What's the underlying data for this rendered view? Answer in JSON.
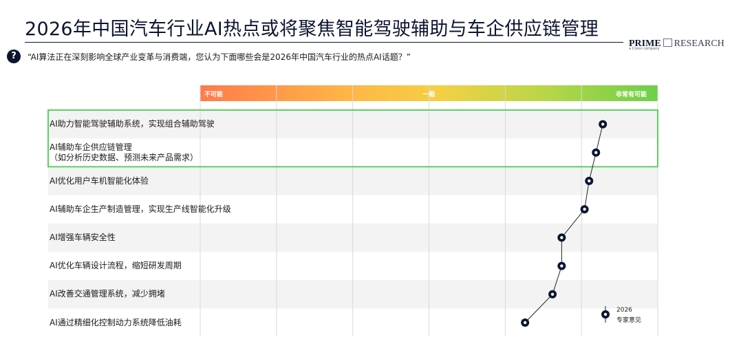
{
  "header": {
    "title": "2026年中国汽车行业AI热点或将聚焦智能驾驶辅助与车企供应链管理",
    "logo_prime": "PRIME",
    "logo_research": "RESEARCH",
    "logo_sub": "a Cision company"
  },
  "question": {
    "icon": "?",
    "text": "“AI算法正在深刻影响全球产业变革与消费端，您认为下面哪些会是2026年中国汽车行业的热点AI话题？”"
  },
  "scale": {
    "low": "不可能",
    "mid": "一般",
    "high": "非常有可能"
  },
  "colors": {
    "navy": "#0c1530",
    "highlight": "#5cd05c",
    "row_shade": "#f3f3f3",
    "scale_start": "#ff7a4a",
    "scale_end": "#6ccf4a"
  },
  "chart_data": {
    "type": "scatter",
    "orientation": "horizontal",
    "xlim": [
      0,
      100
    ],
    "grid": true,
    "legend": {
      "year": "2026",
      "label": "专家意见",
      "position": "bottom-right"
    },
    "categories": [
      [
        "AI助力智能驾驶辅助系统，实现组合辅助驾驶"
      ],
      [
        "AI辅助车企供应链管理",
        "（如分析历史数据、预测未来产品需求）"
      ],
      [
        "AI优化用户车机智能化体验"
      ],
      [
        "AI辅助车企生产制造管理，实现生产线智能化升级"
      ],
      [
        "AI增强车辆安全性"
      ],
      [
        "AI优化车辆设计流程，缩短研发周期"
      ],
      [
        "AI改善交通管理系统，减少拥堵"
      ],
      [
        "AI通过精细化控制动力系统降低油耗"
      ]
    ],
    "highlighted": [
      0,
      1
    ],
    "series": [
      {
        "name": "2026",
        "values": [
          88,
          86.5,
          85,
          84,
          79,
          79,
          77,
          71
        ]
      }
    ]
  }
}
